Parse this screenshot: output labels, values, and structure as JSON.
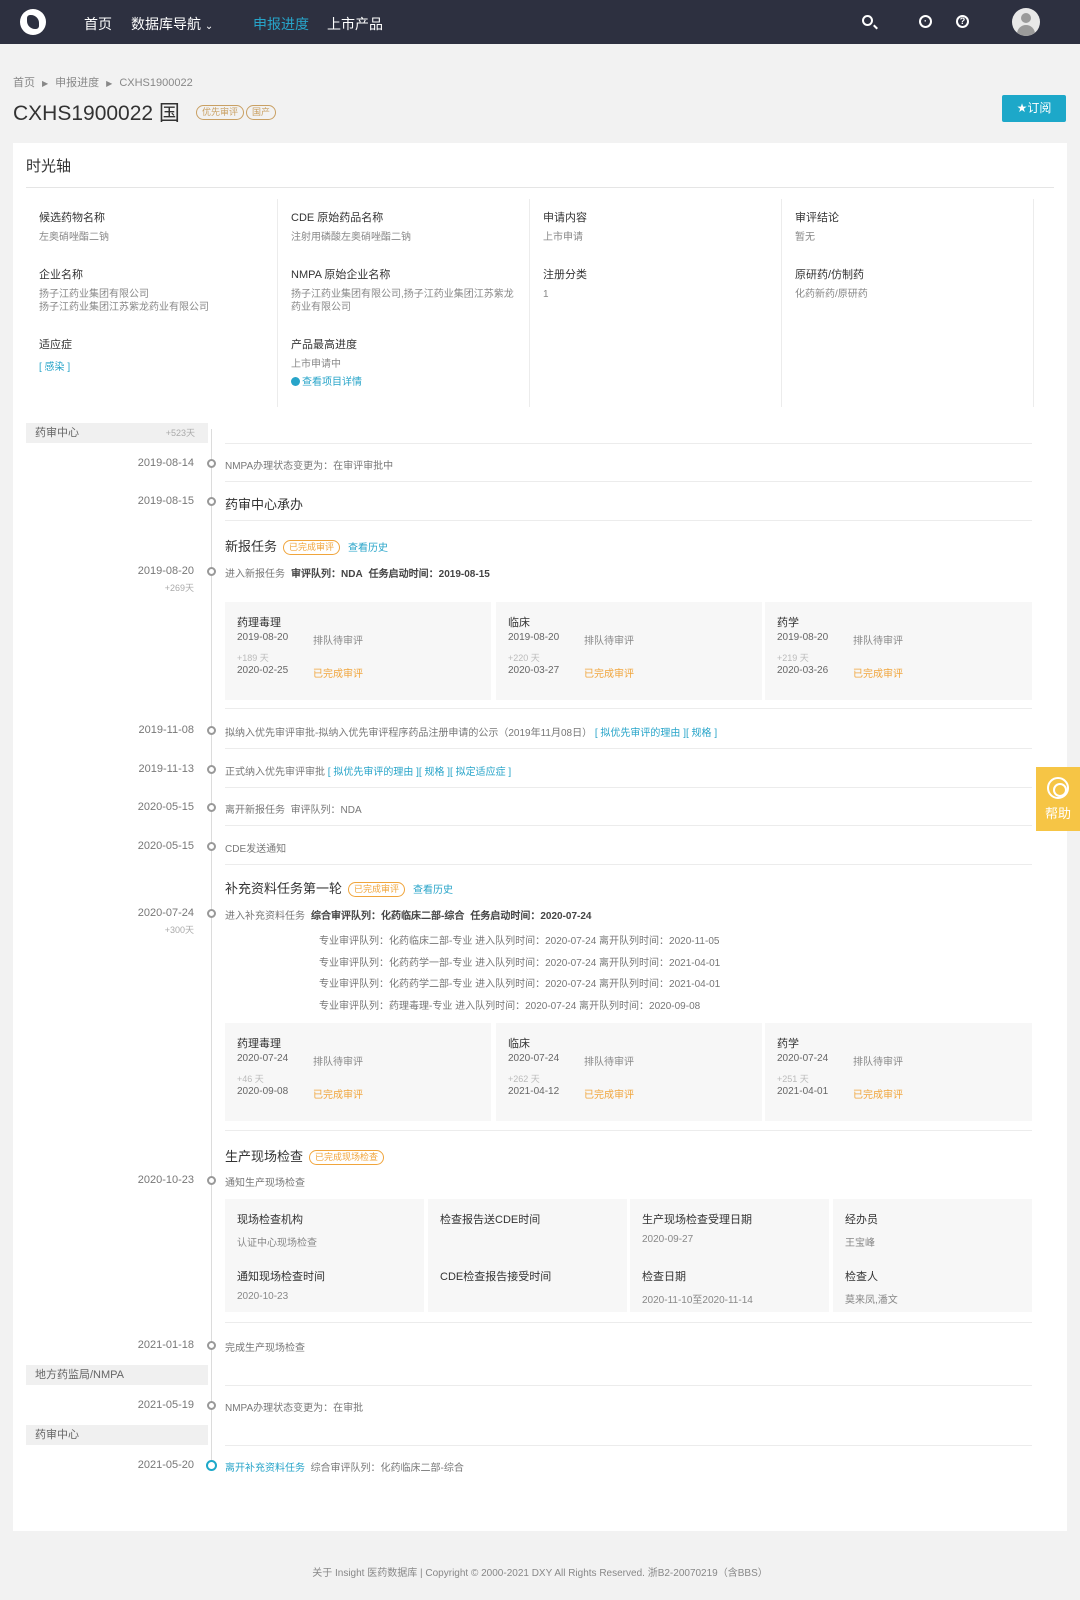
{
  "nav": {
    "items": [
      "首页",
      "数据库导航",
      "申报进度",
      "上市产品"
    ],
    "dropdown_indicator": "⌄",
    "icons": [
      "search-icon",
      "bulb-icon",
      "question-icon",
      "avatar"
    ]
  },
  "breadcrumb": [
    "首页",
    "申报进度",
    "CXHS1900022"
  ],
  "header": {
    "title": "CXHS1900022 国",
    "tags": [
      "优先审评",
      "国产"
    ],
    "subscribe_label": "★订阅"
  },
  "card": {
    "title": "时光轴",
    "info": [
      [
        {
          "label": "候选药物名称",
          "value": "左奥硝唑酯二钠"
        },
        {
          "label": "企业名称",
          "value": "扬子江药业集团有限公司\n扬子江药业集团江苏紫龙药业有限公司"
        },
        {
          "label": "适应症",
          "value": "[ 感染 ]"
        }
      ],
      [
        {
          "label": "CDE 原始药品名称",
          "value": "注射用磷酸左奥硝唑酯二钠"
        },
        {
          "label": "NMPA 原始企业名称",
          "value": "扬子江药业集团有限公司,扬子江药业集团江苏紫龙药业有限公司"
        },
        {
          "label": "产品最高进度",
          "value": "上市申请中",
          "link": "查看项目详情"
        }
      ],
      [
        {
          "label": "申请内容",
          "value": "上市申请"
        },
        {
          "label": "注册分类",
          "value": "1"
        }
      ],
      [
        {
          "label": "审评结论",
          "value": "暂无"
        },
        {
          "label": "原研药/仿制药",
          "value": "化药新药/原研药"
        }
      ]
    ]
  },
  "timeline": {
    "groups": [
      {
        "label": "药审中心",
        "extra": "+523天"
      },
      {
        "label": "地方药监局/NMPA",
        "extra": ""
      },
      {
        "label": "药审中心",
        "extra": ""
      }
    ],
    "events": {
      "e1": {
        "date": "2019-08-14",
        "text": "NMPA办理状态变更为：在审评审批中"
      },
      "e2": {
        "date": "2019-08-15",
        "text": "药审中心承办"
      },
      "task1": {
        "title": "新报任务",
        "tag": "已完成审评",
        "link": "查看历史"
      },
      "e3": {
        "date": "2019-08-20",
        "sub": "+269天",
        "text": "进入新报任务",
        "bold1": "审评队列：NDA",
        "bold2": "任务启动时间：2019-08-15"
      },
      "panels1": [
        {
          "title": "药理毒理",
          "start": "2019-08-20",
          "start_status": "排队待审评",
          "delta": "+189 天",
          "end": "2020-02-25",
          "end_status": "已完成审评"
        },
        {
          "title": "临床",
          "start": "2019-08-20",
          "start_status": "排队待审评",
          "delta": "+220 天",
          "end": "2020-03-27",
          "end_status": "已完成审评"
        },
        {
          "title": "药学",
          "start": "2019-08-20",
          "start_status": "排队待审评",
          "delta": "+219 天",
          "end": "2020-03-26",
          "end_status": "已完成审评"
        }
      ],
      "e4": {
        "date": "2019-11-08",
        "text": "拟纳入优先审评审批-拟纳入优先审评程序药品注册申请的公示（2019年11月08日）",
        "links": "[ 拟优先审评的理由 ][ 规格 ]"
      },
      "e5": {
        "date": "2019-11-13",
        "text": "正式纳入优先审评审批",
        "links": "[ 拟优先审评的理由 ][ 规格 ][ 拟定适应症 ]"
      },
      "e6": {
        "date": "2020-05-15",
        "text": "离开新报任务",
        "extra": "审评队列：NDA"
      },
      "e7": {
        "date": "2020-05-15",
        "text": "CDE发送通知"
      },
      "task2": {
        "title": "补充资料任务第一轮",
        "tag": "已完成审评",
        "link": "查看历史"
      },
      "e8": {
        "date": "2020-07-24",
        "sub": "+300天",
        "text": "进入补充资料任务",
        "bold1": "综合审评队列：化药临床二部-综合",
        "bold2": "任务启动时间：2020-07-24"
      },
      "queues": [
        "专业审评队列：化药临床二部-专业   进入队列时间：2020-07-24   离开队列时间：2020-11-05",
        "专业审评队列：化药药学一部-专业   进入队列时间：2020-07-24   离开队列时间：2021-04-01",
        "专业审评队列：化药药学二部-专业   进入队列时间：2020-07-24   离开队列时间：2021-04-01",
        "专业审评队列：药理毒理-专业   进入队列时间：2020-07-24   离开队列时间：2020-09-08"
      ],
      "panels2": [
        {
          "title": "药理毒理",
          "start": "2020-07-24",
          "start_status": "排队待审评",
          "delta": "+46 天",
          "end": "2020-09-08",
          "end_status": "已完成审评"
        },
        {
          "title": "临床",
          "start": "2020-07-24",
          "start_status": "排队待审评",
          "delta": "+262 天",
          "end": "2021-04-12",
          "end_status": "已完成审评"
        },
        {
          "title": "药学",
          "start": "2020-07-24",
          "start_status": "排队待审评",
          "delta": "+251 天",
          "end": "2021-04-01",
          "end_status": "已完成审评"
        }
      ],
      "task3": {
        "title": "生产现场检查",
        "tag": "已完成现场检查"
      },
      "e9": {
        "date": "2020-10-23",
        "text": "通知生产现场检查"
      },
      "inspection": [
        [
          {
            "label": "现场检查机构",
            "value": "认证中心现场检查"
          },
          {
            "label": "通知现场检查时间",
            "value": "2020-10-23"
          }
        ],
        [
          {
            "label": "检查报告送CDE时间",
            "value": ""
          },
          {
            "label": "CDE检查报告接受时间",
            "value": ""
          }
        ],
        [
          {
            "label": "生产现场检查受理日期",
            "value": "2020-09-27"
          },
          {
            "label": "检查日期",
            "value": "2020-11-10至2020-11-14"
          }
        ],
        [
          {
            "label": "经办员",
            "value": "王宝峰"
          },
          {
            "label": "检查人",
            "value": "莫来凤,潘文"
          }
        ]
      ],
      "e10": {
        "date": "2021-01-18",
        "text": "完成生产现场检查"
      },
      "e11": {
        "date": "2021-05-19",
        "text": "NMPA办理状态变更为：在审批"
      },
      "e12": {
        "date": "2021-05-20",
        "text": "离开补充资料任务",
        "extra": "综合审评队列：化药临床二部-综合"
      }
    }
  },
  "help_label": "帮助",
  "footer": "关于 Insight 医药数据库  |  Copyright © 2000-2021 DXY All Rights Reserved. 浙B2-20070219（含BBS）"
}
